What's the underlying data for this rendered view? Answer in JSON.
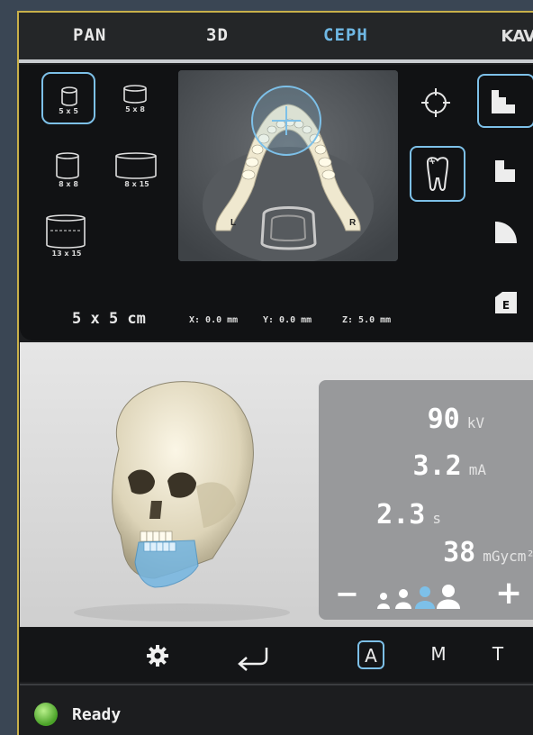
{
  "tabs": [
    {
      "label": "PAN",
      "active": false
    },
    {
      "label": "3D",
      "active": false
    },
    {
      "label": "CEPH",
      "active": true
    }
  ],
  "brand": "KAV",
  "fov_options": [
    {
      "label": "5 x 5",
      "selected": true
    },
    {
      "label": "5 x 8",
      "selected": false
    },
    {
      "label": "8 x 8",
      "selected": false
    },
    {
      "label": "8 x 15",
      "selected": false
    },
    {
      "label": "13 x 15",
      "selected": false
    }
  ],
  "xray": {
    "left_marker": "L",
    "right_marker": "R"
  },
  "volume": {
    "size_label": "5 x 5 cm",
    "x": "X: 0.0 mm",
    "y": "Y: 0.0 mm",
    "z": "Z: 5.0 mm"
  },
  "exposure": {
    "kv": {
      "value": "90",
      "unit": "kV"
    },
    "ma": {
      "value": "3.2",
      "unit": "mA"
    },
    "time": {
      "value": "2.3",
      "unit": "s"
    },
    "dose": {
      "value": "38",
      "unit": "mGycm²"
    }
  },
  "patient_size": {
    "minus": "−",
    "plus": "+",
    "selected_index": 2
  },
  "modes": [
    {
      "label": "A",
      "selected": true
    },
    {
      "label": "M",
      "selected": false
    },
    {
      "label": "T",
      "selected": false
    }
  ],
  "status": {
    "text": "Ready"
  },
  "side_icon_labels": {
    "e_label": "E"
  },
  "colors": {
    "accent": "#7dc0e8",
    "ready": "#5fbf3a"
  }
}
